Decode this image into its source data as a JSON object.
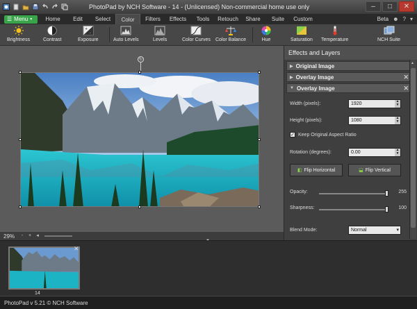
{
  "window": {
    "title": "PhotoPad by NCH Software - 14 - (Unlicensed) Non-commercial home use only",
    "controls": [
      "minimize",
      "maximize",
      "close"
    ]
  },
  "menubar": {
    "menu_label": "Menu",
    "tabs": [
      "Home",
      "Edit",
      "Select",
      "Color",
      "Filters",
      "Effects",
      "Tools",
      "Retouch",
      "Share",
      "Suite",
      "Custom"
    ],
    "active_tab": "Color",
    "beta_label": "Beta"
  },
  "toolbar": {
    "tools": [
      {
        "label": "Brightness",
        "icon": "sun-icon"
      },
      {
        "label": "Contrast",
        "icon": "contrast-icon"
      },
      {
        "label": "Exposure",
        "icon": "exposure-icon"
      },
      {
        "label": "Auto Levels",
        "icon": "auto-levels-icon"
      },
      {
        "label": "Levels",
        "icon": "levels-icon"
      },
      {
        "label": "Color Curves",
        "icon": "color-curves-icon"
      },
      {
        "label": "Color Balance",
        "icon": "color-balance-icon"
      },
      {
        "label": "Hue",
        "icon": "hue-icon"
      },
      {
        "label": "Saturation",
        "icon": "saturation-icon"
      },
      {
        "label": "Temperature",
        "icon": "thermometer-icon"
      },
      {
        "label": "NCH Suite",
        "icon": "nch-suite-icon"
      }
    ]
  },
  "canvas": {
    "zoom": "29%",
    "zoom_buttons": [
      "-",
      "+"
    ]
  },
  "panel": {
    "header": "Effects and Layers",
    "layers": [
      {
        "label": "Original Image",
        "expanded": false,
        "closable": false
      },
      {
        "label": "Overlay Image",
        "expanded": false,
        "closable": true
      },
      {
        "label": "Overlay Image",
        "expanded": true,
        "closable": true
      }
    ],
    "width_label": "Width (pixels):",
    "width_value": "1920",
    "height_label": "Height (pixels):",
    "height_value": "1080",
    "aspect_label": "Keep Original Aspect Ratio",
    "aspect_checked": "✓",
    "rotation_label": "Rotation (degrees):",
    "rotation_value": "0.00",
    "flip_h": "Flip Horizontal",
    "flip_v": "Flip Vertical",
    "opacity_label": "Opacity:",
    "opacity_value": "255",
    "opacity_fraction": 1.0,
    "sharpness_label": "Sharpness:",
    "sharpness_value": "100",
    "sharpness_fraction": 1.0,
    "blend_label": "Blend Mode:",
    "blend_value": "Normal"
  },
  "filmstrip": {
    "items": [
      {
        "label": "14"
      }
    ]
  },
  "status": {
    "text": "PhotoPad v 5.21 © NCH Software"
  },
  "colors": {
    "menu_button": "#3aa44a",
    "close_button": "#b83a2e",
    "water": "#1cb3c4"
  }
}
